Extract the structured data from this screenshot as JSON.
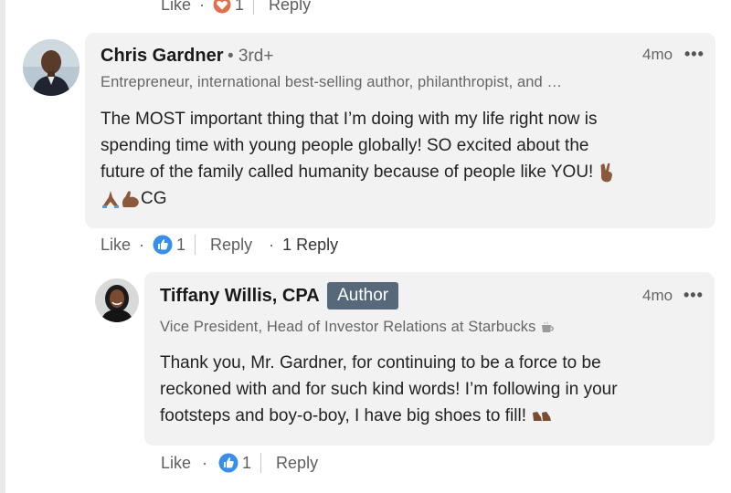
{
  "top_actions": {
    "like": "Like",
    "reaction_count": "1",
    "reply": "Reply"
  },
  "comment1": {
    "author": "Chris Gardner",
    "degree": "3rd+",
    "headline": "Entrepreneur, international best-selling author, philanthropist, and …",
    "time": "4mo",
    "more": "•••",
    "lines": [
      "The MOST important thing that I’m doing with my life right now is",
      "spending time with young people globally! SO excited about the",
      "future of the family called humanity because of people like YOU!",
      "CG"
    ],
    "actions": {
      "like": "Like",
      "reaction_count": "1",
      "reply": "Reply",
      "replies": "1 Reply"
    }
  },
  "comment2": {
    "author": "Tiffany Willis, CPA",
    "badge": "Author",
    "headline": "Vice President, Head of Investor Relations at Starbucks",
    "time": "4mo",
    "more": "•••",
    "lines": [
      "Thank you, Mr. Gardner, for continuing to be a force to be",
      "reckoned with and for such kind words! I’m following in your",
      "footsteps and boy-o-boy, I have big shoes to fill!"
    ],
    "actions": {
      "like": "Like",
      "reaction_count": "1",
      "reply": "Reply"
    }
  },
  "icons": {
    "heart_reaction": "heart-icon",
    "like_reaction": "thumbs-up-icon",
    "victory_hand": "victory-hand-emoji",
    "praying_hands": "praying-hands-emoji",
    "flexed_biceps": "flexed-biceps-emoji",
    "coffee": "coffee-emoji",
    "shoes": "shoe-emoji"
  },
  "colors": {
    "bubble_bg": "#f2f2f2",
    "badge_bg": "#56687a",
    "like_blue": "#378fe9",
    "heart_red": "#df704d"
  }
}
